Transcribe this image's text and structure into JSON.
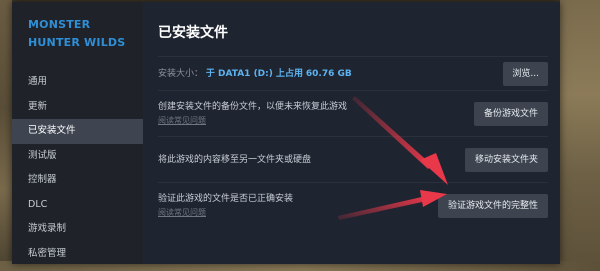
{
  "sidebar": {
    "game_title_line1": "MONSTER",
    "game_title_line2": "HUNTER WILDS",
    "items": [
      {
        "label": "通用"
      },
      {
        "label": "更新"
      },
      {
        "label": "已安装文件",
        "active": true
      },
      {
        "label": "测试版"
      },
      {
        "label": "控制器"
      },
      {
        "label": "DLC"
      },
      {
        "label": "游戏录制"
      },
      {
        "label": "私密管理"
      }
    ]
  },
  "main": {
    "title": "已安装文件",
    "install_size": {
      "label": "安装大小：",
      "drive": "于 DATA1 (D:) 上占用",
      "size": "60.76 GB",
      "button": "浏览..."
    },
    "backup": {
      "text": "创建安装文件的备份文件，以便未来恢复此游戏",
      "faq": "阅读常见问题",
      "button": "备份游戏文件"
    },
    "move": {
      "text": "将此游戏的内容移至另一文件夹或硬盘",
      "button": "移动安装文件夹"
    },
    "verify": {
      "text": "验证此游戏的文件是否已正确安装",
      "faq": "阅读常见问题",
      "button": "验证游戏文件的完整性"
    }
  },
  "colors": {
    "accent": "#2f8fd6",
    "arrow": "#e8384a",
    "panel": "#1e2430",
    "sidebar": "#1f2329",
    "active_item": "#3e4550"
  }
}
